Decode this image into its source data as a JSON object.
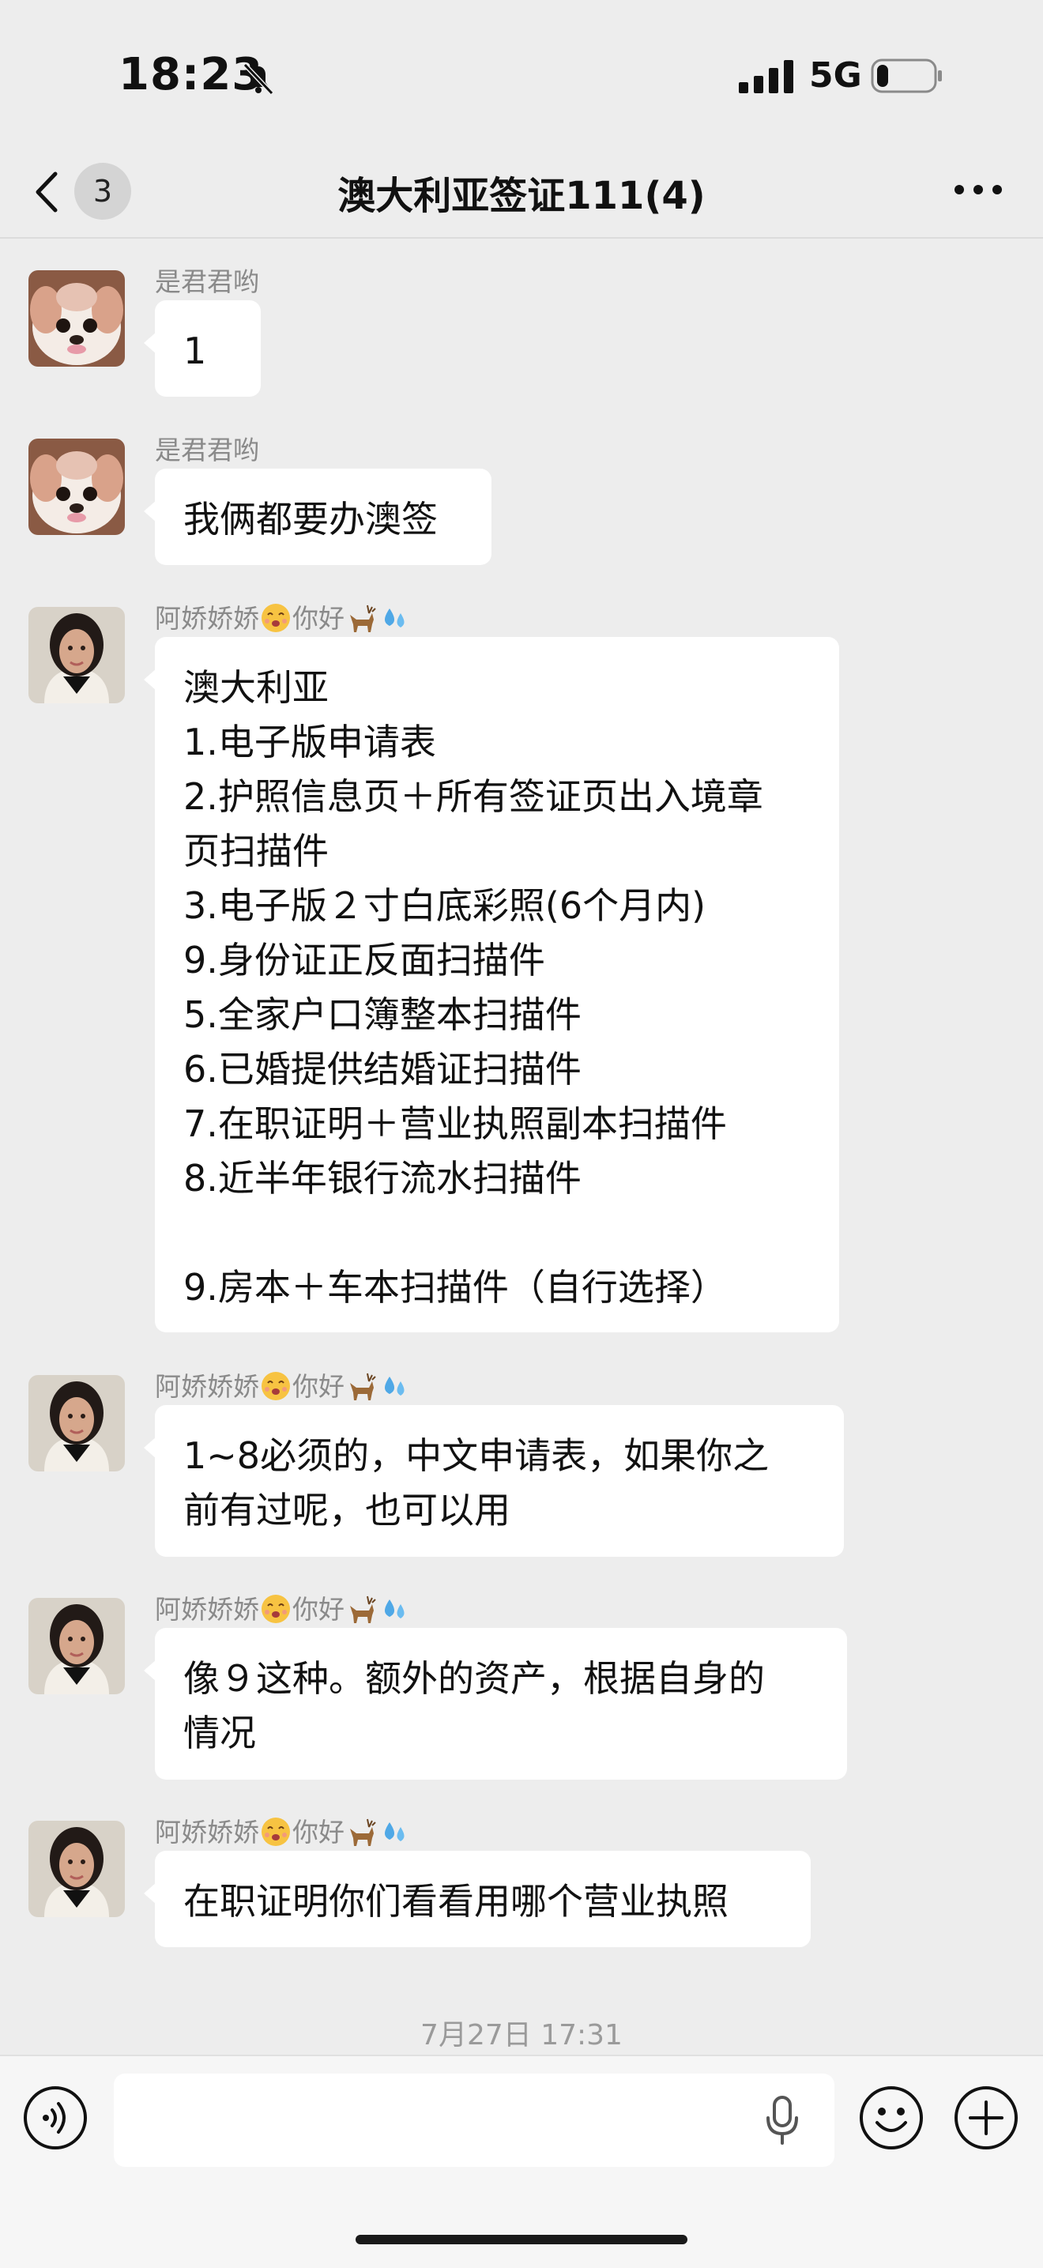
{
  "status_bar": {
    "time": "18:23",
    "network": "5G",
    "battery_level": 0.2
  },
  "header": {
    "back_badge": "3",
    "title": "澳大利亚签证111(4)"
  },
  "messages": [
    {
      "sender": "是君君哟",
      "text": "1"
    },
    {
      "sender": "是君君哟",
      "text": "我俩都要办澳签"
    },
    {
      "sender": "阿娇娇娇",
      "sender_suffix": "你好",
      "text": "澳大利亚\n1.电子版申请表\n2.护照信息页＋所有签证页出入境章\n页扫描件\n3.电子版２寸白底彩照(6个月内)\n9.身份证正反面扫描件\n5.全家户口簿整本扫描件\n6.已婚提供结婚证扫描件\n7.在职证明＋营业执照副本扫描件\n8.近半年银行流水扫描件\n\n9.房本＋车本扫描件（自行选择）"
    },
    {
      "sender": "阿娇娇娇",
      "sender_suffix": "你好",
      "text": "1~8必须的，中文申请表，如果你之\n前有过呢，也可以用"
    },
    {
      "sender": "阿娇娇娇",
      "sender_suffix": "你好",
      "text": "像９这种。额外的资产，根据自身的\n情况"
    },
    {
      "sender": "阿娇娇娇",
      "sender_suffix": "你好",
      "text": "在职证明你们看看用哪个营业执照"
    }
  ],
  "timestamp": "7月27日 17:31",
  "input": {
    "placeholder": "",
    "value": ""
  },
  "icons": {
    "status": [
      "mute-bell-icon",
      "signal-icon",
      "battery-icon"
    ],
    "header": [
      "back-chevron-icon",
      "more-icon"
    ],
    "input_bar": [
      "voice-icon",
      "mic-icon",
      "emoji-icon",
      "plus-icon"
    ]
  },
  "colors": {
    "background": "#ededed",
    "bubble": "#ffffff",
    "input_bar": "#f6f6f6",
    "muted_text": "#8a8a8a"
  }
}
